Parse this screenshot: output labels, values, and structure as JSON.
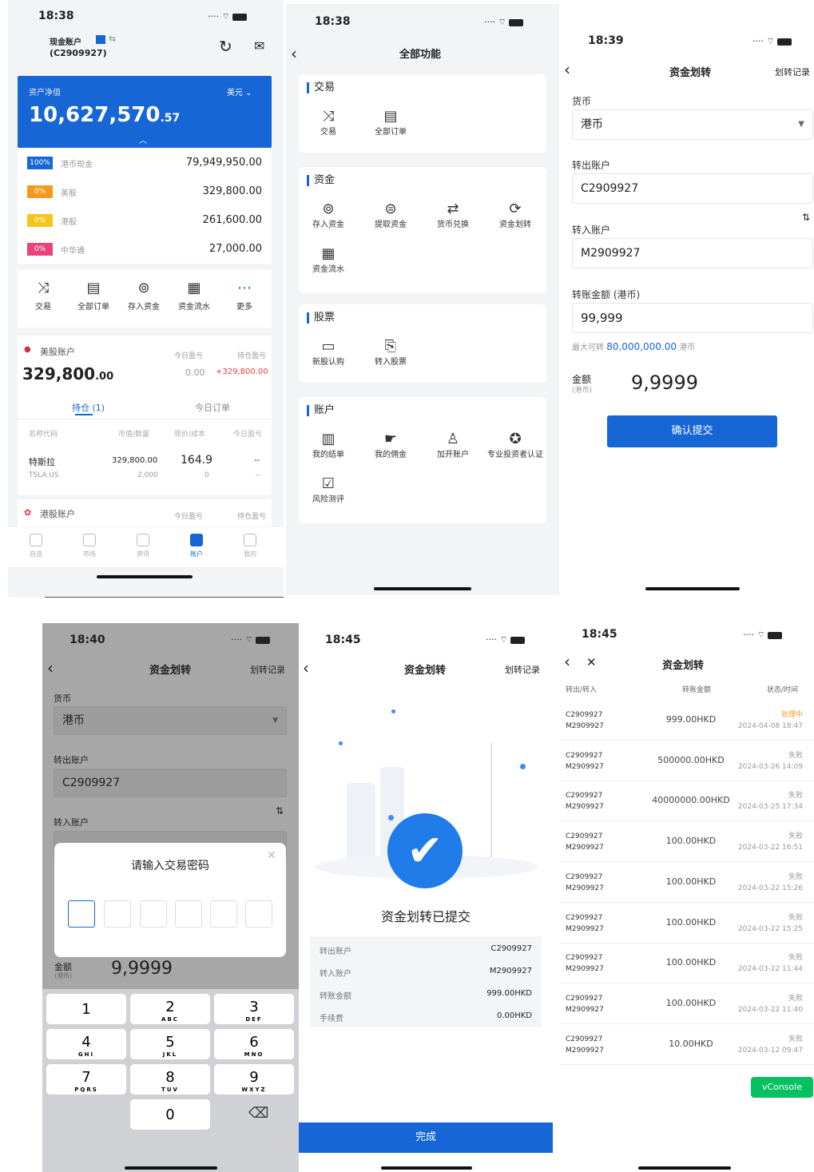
{
  "colors": {
    "accent": "#1766d6",
    "positive": "#e8413c",
    "vconsole": "#05c160"
  },
  "s1": {
    "time": "18:38",
    "account_name": "现金账户",
    "account_id": "(C2909927)",
    "asset_label": "资产净值",
    "asset_currency": "美元",
    "asset_value": "10,627,570",
    "asset_decimal": ".57",
    "rows": [
      {
        "pct": "100%",
        "name": "港币现金",
        "value": "79,949,950.00",
        "color": "#1766d6"
      },
      {
        "pct": "0%",
        "name": "美股",
        "value": "329,800.00",
        "color": "#f39a1e"
      },
      {
        "pct": "0%",
        "name": "港股",
        "value": "261,600.00",
        "color": "#f5c51b"
      },
      {
        "pct": "0%",
        "name": "中华通",
        "value": "27,000.00",
        "color": "#e8437a"
      }
    ],
    "quick": [
      {
        "label": "交易",
        "icon": "shuffle-icon"
      },
      {
        "label": "全部订单",
        "icon": "document-icon"
      },
      {
        "label": "存入资金",
        "icon": "deposit-icon"
      },
      {
        "label": "资金流水",
        "icon": "ledger-icon"
      },
      {
        "label": "更多",
        "icon": "more-icon"
      }
    ],
    "us_title": "美股账户",
    "us_value": "329,800",
    "us_value_dec": ".00",
    "today_pl_label": "今日盈亏",
    "hold_pl_label": "持仓盈亏",
    "today_pl": "0.00",
    "hold_pl": "+329,800.00",
    "tab_position": "持仓 (1)",
    "tab_orders": "今日订单",
    "col_headers": [
      "名称代码",
      "市值/数量",
      "现价/成本",
      "今日盈亏"
    ],
    "stock": {
      "name": "特斯拉",
      "code": "TSLA.US",
      "mv": "329,800.00",
      "qty": "2,000",
      "price": "164.9",
      "cost": "0",
      "pl": "--",
      "pl2": "--"
    },
    "hk_title": "港股账户",
    "hk_today": "今日盈亏",
    "hk_hold": "持仓盈亏",
    "tabs": [
      "自选",
      "市场",
      "资讯",
      "账户",
      "我的"
    ]
  },
  "s2": {
    "time": "18:38",
    "title": "全部功能",
    "sections": [
      {
        "title": "交易",
        "items": [
          {
            "label": "交易",
            "icon": "shuffle-icon"
          },
          {
            "label": "全部订单",
            "icon": "document-icon"
          }
        ]
      },
      {
        "title": "资金",
        "items": [
          {
            "label": "存入资金",
            "icon": "deposit-icon"
          },
          {
            "label": "提取资金",
            "icon": "withdraw-icon"
          },
          {
            "label": "货币兑换",
            "icon": "exchange-icon"
          },
          {
            "label": "资金划转",
            "icon": "transfer-icon"
          },
          {
            "label": "资金流水",
            "icon": "ledger-icon"
          }
        ]
      },
      {
        "title": "股票",
        "items": [
          {
            "label": "新股认购",
            "icon": "ipo-icon"
          },
          {
            "label": "转入股票",
            "icon": "stock-in-icon"
          }
        ]
      },
      {
        "title": "账户",
        "items": [
          {
            "label": "我的结单",
            "icon": "statement-icon"
          },
          {
            "label": "我的佣金",
            "icon": "commission-icon"
          },
          {
            "label": "加开账户",
            "icon": "add-account-icon"
          },
          {
            "label": "专业投资者认证",
            "icon": "certificate-icon"
          },
          {
            "label": "风险测评",
            "icon": "risk-icon"
          }
        ]
      }
    ]
  },
  "s3": {
    "time": "18:39",
    "title": "资金划转",
    "record_link": "划转记录",
    "currency_label": "货币",
    "currency_value": "港币",
    "from_label": "转出账户",
    "from_value": "C2909927",
    "to_label": "转入账户",
    "to_value": "M2909927",
    "amount_label": "转账金额 (港币)",
    "amount_value": "99,999",
    "max_label": "最大可转",
    "max_value": "80,000,000.00",
    "max_unit": "港币",
    "total_label": "金额",
    "total_unit": "(港币)",
    "total_value": "9,9999",
    "submit": "确认提交"
  },
  "s4": {
    "time": "18:40",
    "title": "资金划转",
    "record_link": "划转记录",
    "currency_label": "货币",
    "currency_value": "港币",
    "from_label": "转出账户",
    "from_value": "C2909927",
    "to_label": "转入账户",
    "dialog_title": "请输入交易密码",
    "total_label": "金额",
    "total_unit": "(港币)",
    "total_value": "9,9999",
    "keys": [
      {
        "n": "1",
        "s": ""
      },
      {
        "n": "2",
        "s": "ABC"
      },
      {
        "n": "3",
        "s": "DEF"
      },
      {
        "n": "4",
        "s": "GHI"
      },
      {
        "n": "5",
        "s": "JKL"
      },
      {
        "n": "6",
        "s": "MNO"
      },
      {
        "n": "7",
        "s": "PQRS"
      },
      {
        "n": "8",
        "s": "TUV"
      },
      {
        "n": "9",
        "s": "WXYZ"
      },
      {
        "n": "0",
        "s": ""
      }
    ]
  },
  "s5": {
    "time": "18:45",
    "title": "资金划转",
    "record_link": "划转记录",
    "status": "资金划转已提交",
    "rows": [
      {
        "k": "转出账户",
        "v": "C2909927"
      },
      {
        "k": "转入账户",
        "v": "M2909927"
      },
      {
        "k": "转账金额",
        "v": "999.00HKD"
      },
      {
        "k": "手续费",
        "v": "0.00HKD"
      }
    ],
    "done": "完成"
  },
  "s6": {
    "time": "18:45",
    "title": "资金划转",
    "headers": [
      "转出/转入",
      "转账金额",
      "状态/时间"
    ],
    "records": [
      {
        "from": "C2909927",
        "to": "M2909927",
        "amount": "999.00HKD",
        "status": "处理中",
        "time": "2024-04-08 18:47"
      },
      {
        "from": "C2909927",
        "to": "M2909927",
        "amount": "500000.00HKD",
        "status": "失败",
        "time": "2024-03-26 14:09"
      },
      {
        "from": "C2909927",
        "to": "M2909927",
        "amount": "40000000.00HKD",
        "status": "失败",
        "time": "2024-03-25 17:34"
      },
      {
        "from": "C2909927",
        "to": "M2909927",
        "amount": "100.00HKD",
        "status": "失败",
        "time": "2024-03-22 16:51"
      },
      {
        "from": "C2909927",
        "to": "M2909927",
        "amount": "100.00HKD",
        "status": "失败",
        "time": "2024-03-22 15:26"
      },
      {
        "from": "C2909927",
        "to": "M2909927",
        "amount": "100.00HKD",
        "status": "失败",
        "time": "2024-03-22 15:25"
      },
      {
        "from": "C2909927",
        "to": "M2909927",
        "amount": "100.00HKD",
        "status": "失败",
        "time": "2024-03-22 11:44"
      },
      {
        "from": "C2909927",
        "to": "M2909927",
        "amount": "100.00HKD",
        "status": "失败",
        "time": "2024-03-22 11:40"
      },
      {
        "from": "C2909927",
        "to": "M2909927",
        "amount": "10.00HKD",
        "status": "失败",
        "time": "2024-03-12 09:47"
      }
    ],
    "vconsole": "vConsole"
  }
}
